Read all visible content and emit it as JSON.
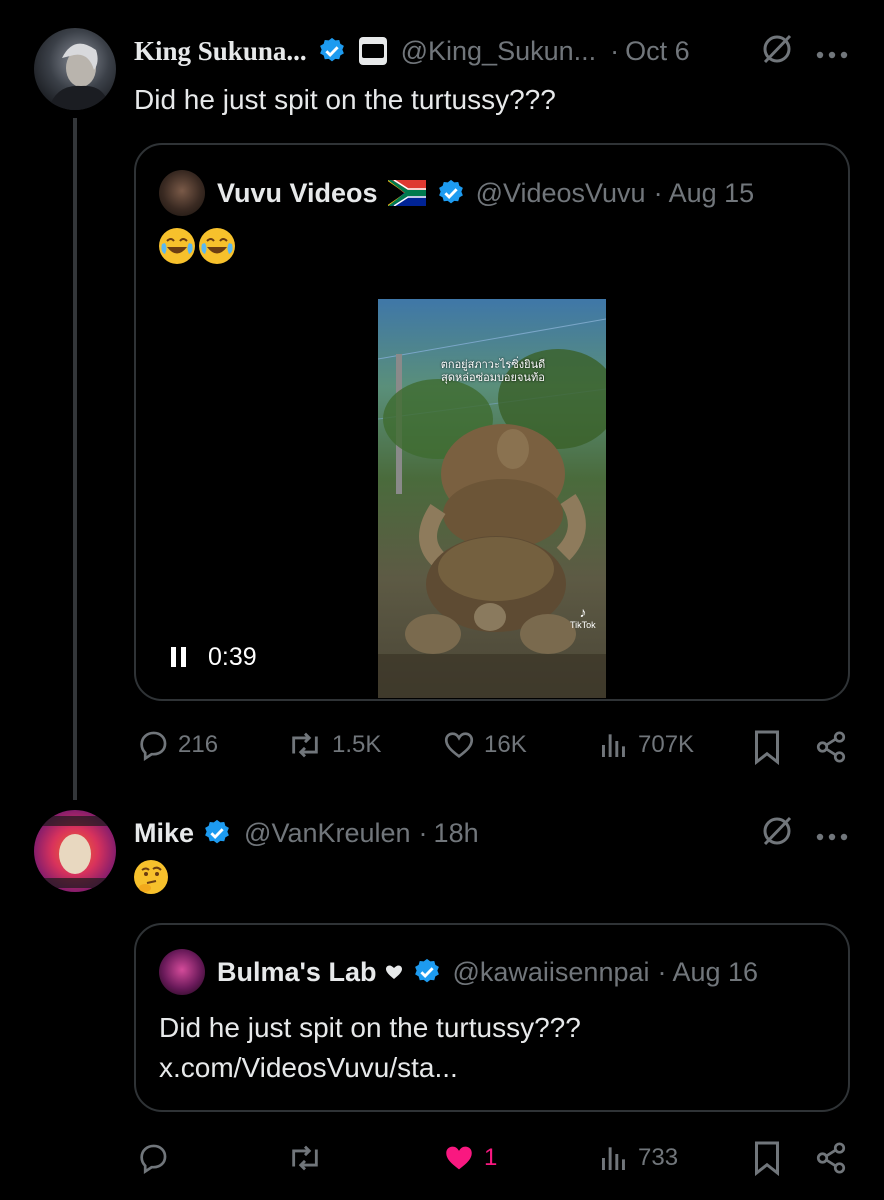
{
  "tweet1": {
    "display_name": "King Sukuna...",
    "handle": "@King_Sukun...",
    "separator": "·",
    "date": "Oct 6",
    "text": "Did he just spit on the turtussy???",
    "quote": {
      "display_name": "Vuvu Videos",
      "handle": "@VideosVuvu",
      "separator": "·",
      "date": "Aug 15",
      "emoji_text": "😂😂",
      "video": {
        "time": "0:39",
        "overlay_text_line1": "ตกอยู่สภาวะไรซิ่งยินดี",
        "overlay_text_line2": "สุดหล่อซ่อมบอยจนท้อ",
        "tiktok_label": "TikTok"
      }
    },
    "actions": {
      "replies": "216",
      "reposts": "1.5K",
      "likes": "16K",
      "views": "707K"
    }
  },
  "tweet2": {
    "display_name": "Mike",
    "handle": "@VanKreulen",
    "separator": "·",
    "date": "18h",
    "emoji_text": "🤔",
    "quote": {
      "display_name": "Bulma's Lab",
      "handle": "@kawaiisennpai",
      "separator": "·",
      "date": "Aug 16",
      "text_line1": "Did he just spit on the turtussy???",
      "text_line2": "x.com/VideosVuvu/sta..."
    },
    "actions": {
      "likes": "1",
      "views": "733"
    }
  },
  "icons": {
    "verified": "verified-badge-icon",
    "more": "more-icon",
    "grok": "grok-icon",
    "reply": "reply-icon",
    "repost": "repost-icon",
    "like": "like-icon",
    "views": "views-icon",
    "bookmark": "bookmark-icon",
    "share": "share-icon",
    "pause": "pause-icon",
    "flag": "south-africa-flag-icon"
  },
  "colors": {
    "background": "#000000",
    "verified": "#1d9bf0",
    "liked": "#f91880",
    "muted": "#71767b",
    "border": "#2f3336"
  }
}
